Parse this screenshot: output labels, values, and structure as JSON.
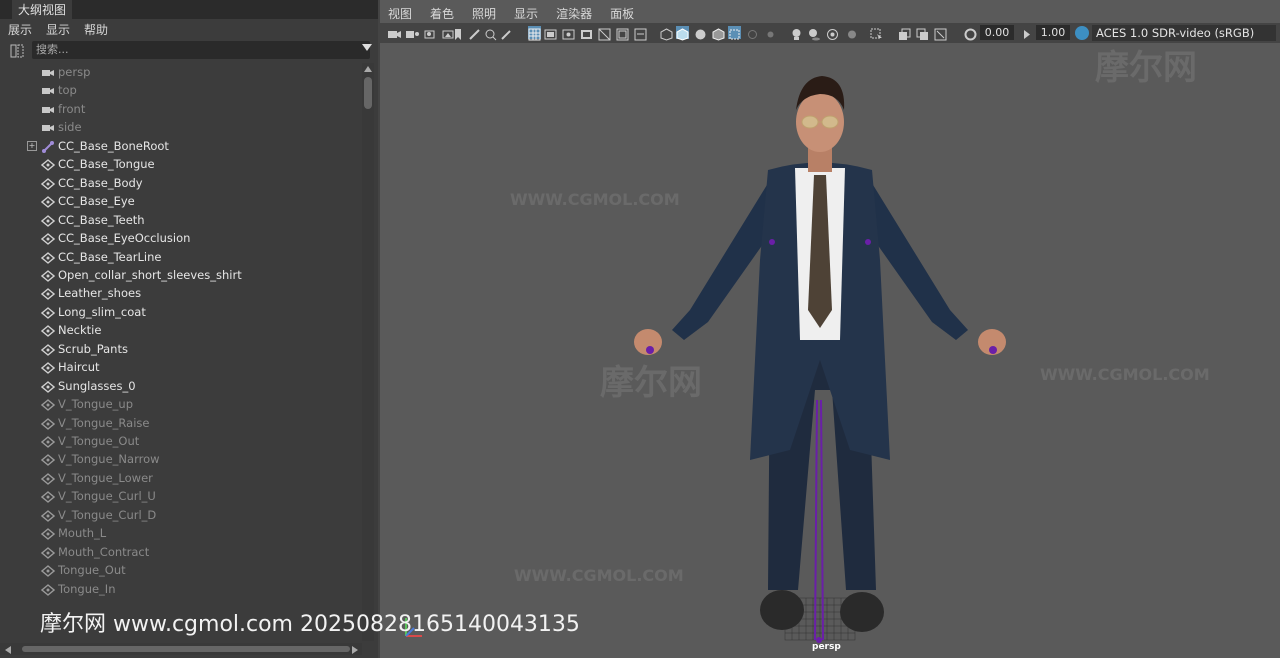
{
  "outliner": {
    "title": "大纲视图",
    "menu": [
      "展示",
      "显示",
      "帮助"
    ],
    "search_placeholder": "搜索...",
    "items": [
      {
        "label": "persp",
        "type": "camera",
        "style": "dim",
        "expand": false
      },
      {
        "label": "top",
        "type": "camera",
        "style": "dim",
        "expand": false
      },
      {
        "label": "front",
        "type": "camera",
        "style": "dim",
        "expand": false
      },
      {
        "label": "side",
        "type": "camera",
        "style": "dim",
        "expand": false
      },
      {
        "label": "CC_Base_BoneRoot",
        "type": "joint",
        "style": "bright",
        "expand": true
      },
      {
        "label": "CC_Base_Tongue",
        "type": "mesh",
        "style": "bright",
        "expand": false
      },
      {
        "label": "CC_Base_Body",
        "type": "mesh",
        "style": "bright",
        "expand": false
      },
      {
        "label": "CC_Base_Eye",
        "type": "mesh",
        "style": "bright",
        "expand": false
      },
      {
        "label": "CC_Base_Teeth",
        "type": "mesh",
        "style": "bright",
        "expand": false
      },
      {
        "label": "CC_Base_EyeOcclusion",
        "type": "mesh",
        "style": "bright",
        "expand": false
      },
      {
        "label": "CC_Base_TearLine",
        "type": "mesh",
        "style": "bright",
        "expand": false
      },
      {
        "label": "Open_collar_short_sleeves_shirt",
        "type": "mesh",
        "style": "bright",
        "expand": false
      },
      {
        "label": "Leather_shoes",
        "type": "mesh",
        "style": "bright",
        "expand": false
      },
      {
        "label": "Long_slim_coat",
        "type": "mesh",
        "style": "bright",
        "expand": false
      },
      {
        "label": "Necktie",
        "type": "mesh",
        "style": "bright",
        "expand": false
      },
      {
        "label": "Scrub_Pants",
        "type": "mesh",
        "style": "bright",
        "expand": false
      },
      {
        "label": "Haircut",
        "type": "mesh",
        "style": "bright",
        "expand": false
      },
      {
        "label": "Sunglasses_0",
        "type": "mesh",
        "style": "bright",
        "expand": false
      },
      {
        "label": "V_Tongue_up",
        "type": "mesh",
        "style": "dim",
        "expand": false
      },
      {
        "label": "V_Tongue_Raise",
        "type": "mesh",
        "style": "dim",
        "expand": false
      },
      {
        "label": "V_Tongue_Out",
        "type": "mesh",
        "style": "dim",
        "expand": false
      },
      {
        "label": "V_Tongue_Narrow",
        "type": "mesh",
        "style": "dim",
        "expand": false
      },
      {
        "label": "V_Tongue_Lower",
        "type": "mesh",
        "style": "dim",
        "expand": false
      },
      {
        "label": "V_Tongue_Curl_U",
        "type": "mesh",
        "style": "dim",
        "expand": false
      },
      {
        "label": "V_Tongue_Curl_D",
        "type": "mesh",
        "style": "dim",
        "expand": false
      },
      {
        "label": "Mouth_L",
        "type": "mesh",
        "style": "dim",
        "expand": false
      },
      {
        "label": "Mouth_Contract",
        "type": "mesh",
        "style": "dim",
        "expand": false
      },
      {
        "label": "Tongue_Out",
        "type": "mesh",
        "style": "dim",
        "expand": false
      },
      {
        "label": "Tongue_In",
        "type": "mesh",
        "style": "dim",
        "expand": false
      }
    ]
  },
  "viewport": {
    "menu": [
      "视图",
      "着色",
      "照明",
      "显示",
      "渲染器",
      "面板"
    ],
    "exposure": "0.00",
    "gamma": "1.00",
    "color_space": "ACES 1.0 SDR-video (sRGB)",
    "camera_label": "persp"
  },
  "watermark": {
    "brand": "摩尔网",
    "site": "WWW.CGMOL.COM",
    "bottom_text": "摩尔网 www.cgmol.com 20250828165140043135"
  },
  "colors": {
    "panel_bg": "#3c3c3c",
    "viewport_bg": "#5a5a5a",
    "accent": "#5b8fb5",
    "skeleton": "#6a1fa8"
  }
}
